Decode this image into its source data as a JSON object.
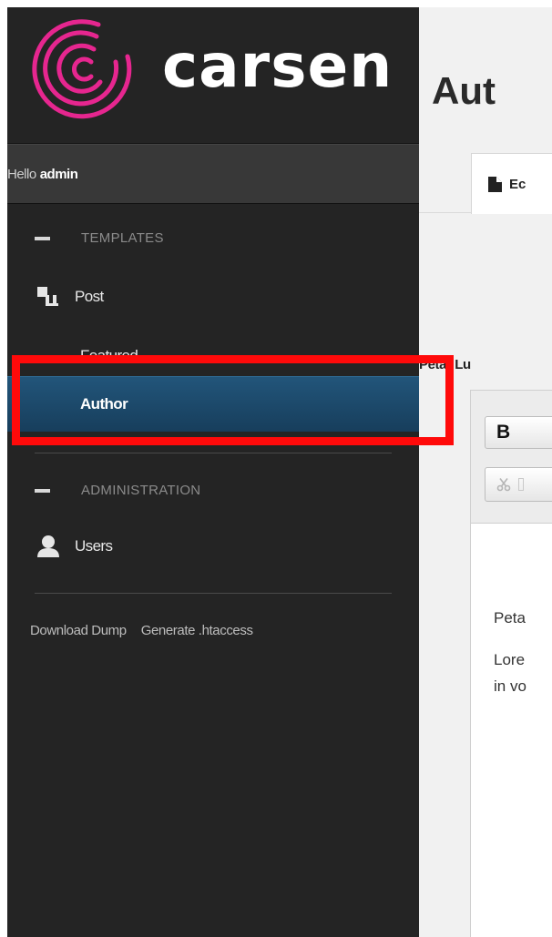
{
  "app": {
    "logo_text": "carsen",
    "brand_color": "#e6268f"
  },
  "user_bar": {
    "greeting": "Hello",
    "username": "admin"
  },
  "sidebar": {
    "sections": [
      {
        "title": "TEMPLATES",
        "items": [
          {
            "label": "Post",
            "icon": "post-icon",
            "children": [
              {
                "label": "Featured"
              },
              {
                "label": "Author",
                "active": true
              }
            ]
          }
        ]
      },
      {
        "title": "ADMINISTRATION",
        "items": [
          {
            "label": "Users",
            "icon": "user-icon"
          }
        ]
      }
    ],
    "footer_links": [
      "Download Dump",
      "Generate .htaccess"
    ]
  },
  "main": {
    "title": "Aut",
    "tab_label": "Ec",
    "field_label": "Petar Lu",
    "editor": {
      "bold_label": "B",
      "paragraphs": [
        "Peta",
        "Lore",
        "in vo"
      ]
    }
  },
  "colors": {
    "sidebar_bg": "#242424",
    "active_item_bg": "#1d4a6d",
    "highlight": "#ff0a0a"
  }
}
